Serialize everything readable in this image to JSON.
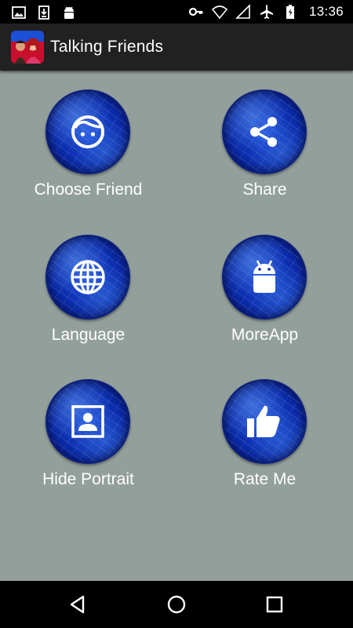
{
  "status_bar": {
    "left_icons": [
      "image-icon",
      "download-icon",
      "android-icon"
    ],
    "right_icons": [
      "key-icon",
      "wifi-icon",
      "signal-icon",
      "airplane-icon",
      "battery-icon"
    ],
    "time": "13:36"
  },
  "app_bar": {
    "title": "Talking Friends",
    "icon": "talking-friends-app-icon"
  },
  "menu": {
    "items": [
      {
        "label": "Choose Friend",
        "icon": "face-icon"
      },
      {
        "label": "Share",
        "icon": "share-icon"
      },
      {
        "label": "Language",
        "icon": "globe-icon"
      },
      {
        "label": "MoreApp",
        "icon": "android-icon"
      },
      {
        "label": "Hide Portrait",
        "icon": "portrait-icon"
      },
      {
        "label": "Rate Me",
        "icon": "thumbs-up-icon"
      }
    ]
  },
  "nav_bar": {
    "buttons": [
      "back-icon",
      "home-icon",
      "recents-icon"
    ]
  },
  "colors": {
    "content_background": "#939f9b",
    "app_bar_background": "#212121",
    "button_blue": "#0b2aa8",
    "text": "#ffffff"
  }
}
